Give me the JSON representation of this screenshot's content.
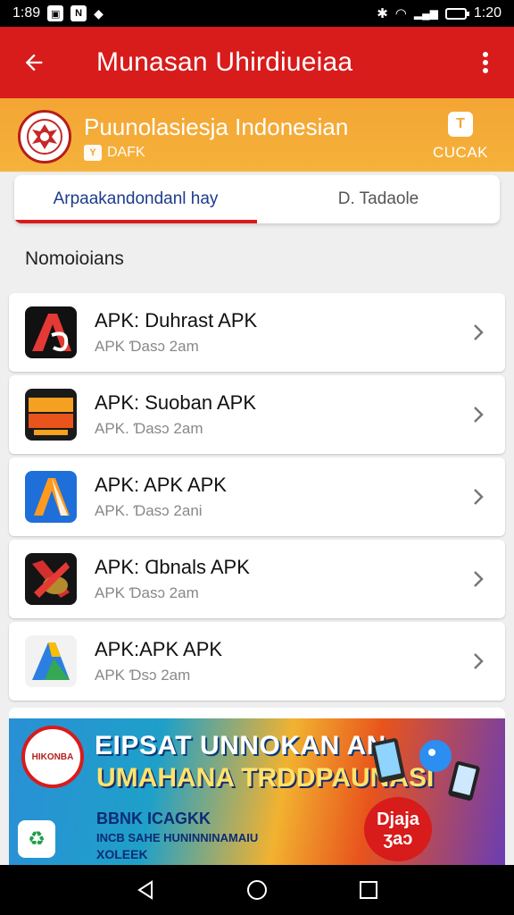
{
  "status_bar": {
    "time_left": "1:89",
    "time_right": "1:20",
    "icon1": "N"
  },
  "app_bar": {
    "title": "Munasan Uhirdiueiaa"
  },
  "header": {
    "title": "Puunolasiesja Indonesian",
    "subtitle": "DAFK",
    "action_label": "CUCAK",
    "action_icon_text": "T"
  },
  "tabs": [
    {
      "label": "Arpaakandondanl hay",
      "active": true
    },
    {
      "label": "D. Tadaole",
      "active": false
    }
  ],
  "section": {
    "title": "Nomoioians"
  },
  "apps": [
    {
      "name": "APK: Duhrast APK",
      "meta": "APK Ɗasɔ 2am",
      "icon": "a-logo-black-red-icon"
    },
    {
      "name": "APK: Suoban APK",
      "meta": "APK. Ɗasɔ 2am",
      "icon": "hava-ocra-logo-icon"
    },
    {
      "name": "APK: APK APK",
      "meta": "APK. Ɗasɔ 2ani",
      "icon": "a-logo-blue-orange-icon"
    },
    {
      "name": "APK: Ɑbnals APK",
      "meta": "APK Ɗasɔ 2am",
      "icon": "x-logo-red-gold-icon"
    },
    {
      "name": "APK:APK APK",
      "meta": "APK Ɗsɔ 2am",
      "icon": "a-logo-blue-green-icon"
    }
  ],
  "banner": {
    "logo_text": "HIKONBA",
    "line1": "EIPSAT UNNOKAN AN",
    "line2": "UMAHANA TRDDPAUNASI",
    "line3": "BBNK ICAGKK",
    "line4": "INCB SAHE HUNINNINAMAIU",
    "line5": "XOLEEK",
    "badge_line1": "Djaja",
    "badge_line2": "ʒaɔ"
  },
  "colors": {
    "primary": "#d81b1b",
    "accent": "#f4a534",
    "tab_text": "#1c3c8c"
  }
}
